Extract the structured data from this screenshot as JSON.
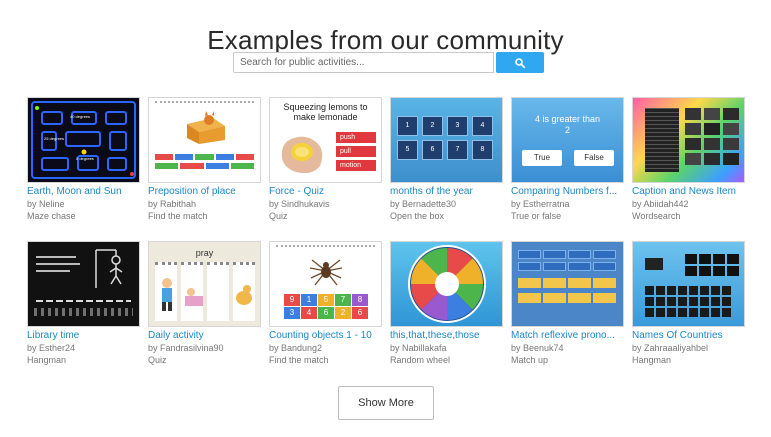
{
  "page": {
    "title": "Examples from our community"
  },
  "search": {
    "placeholder": "Search for public activities..."
  },
  "cards": [
    {
      "title": "Earth, Moon and Sun",
      "author": "by Neline",
      "type": "Maze chase"
    },
    {
      "title": "Preposition of place",
      "author": "by Rabithah",
      "type": "Find the match"
    },
    {
      "title": "Force - Quiz",
      "author": "by Sindhukavis",
      "type": "Quiz"
    },
    {
      "title": "months of the year",
      "author": "by Bernadette30",
      "type": "Open the box"
    },
    {
      "title": "Comparing Numbers f...",
      "author": "by Estherratna",
      "type": "True or false"
    },
    {
      "title": "Caption and News Item",
      "author": "by Abiidah442",
      "type": "Wordsearch"
    },
    {
      "title": "Library time",
      "author": "by Esther24",
      "type": "Hangman"
    },
    {
      "title": "Daily activity",
      "author": "by Fandrasilvina90",
      "type": "Quiz"
    },
    {
      "title": "Counting objects 1 - 10",
      "author": "by Bandung2",
      "type": "Find the match"
    },
    {
      "title": "this,that,these,those",
      "author": "by Nabillakafa",
      "type": "Random wheel"
    },
    {
      "title": "Match reflexive prono...",
      "author": "by Beenuk74",
      "type": "Match up"
    },
    {
      "title": "Names Of Countries",
      "author": "by Zahraaaliyahbel",
      "type": "Hangman"
    }
  ],
  "thumbs": {
    "maze_labels": [
      "40 degrees",
      "25 degrees",
      "0 degrees"
    ],
    "force_caption": "Squeezing lemons to make lemonade",
    "force_buttons": [
      "push",
      "pull",
      "motion"
    ],
    "open_box_numbers": [
      "1",
      "2",
      "3",
      "4",
      "5",
      "6",
      "7",
      "8"
    ],
    "tf_question": "4 is greater than 2",
    "tf_true": "True",
    "tf_false": "False",
    "quiz_word": "pray",
    "count_numbers": [
      "9",
      "1",
      "5",
      "7",
      "8",
      "3",
      "4",
      "6",
      "2",
      "6"
    ]
  },
  "show_more_label": "Show More",
  "icons": {
    "search": "search-icon"
  },
  "colors": {
    "accent": "#2fa8f1",
    "link": "#1d87c8"
  }
}
